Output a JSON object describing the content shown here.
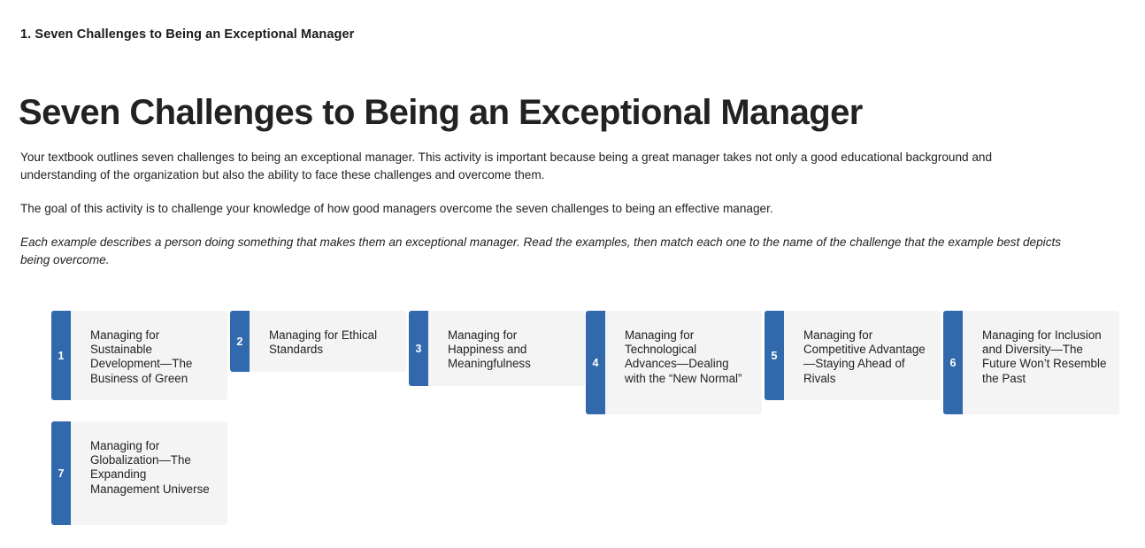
{
  "breadcrumb": "1. Seven Challenges to Being an Exceptional Manager",
  "page_title": "Seven Challenges to Being an Exceptional Manager",
  "body": {
    "intro": "Your textbook outlines seven challenges to being an exceptional manager. This activity is important because being a great manager takes not only a good educational background and understanding of the organization but also the ability to face these challenges and overcome them.",
    "goal": "The goal of this activity is to challenge your knowledge of how good managers overcome the seven challenges to being an effective manager.",
    "instructions": "Each example describes a person doing something that makes them an exceptional manager. Read the examples, then match each one to the name of the challenge that the example best depicts being overcome."
  },
  "colors": {
    "tab_blue": "#3169ac",
    "card_bg": "#f4f4f4",
    "text": "#222222"
  },
  "cards": [
    {
      "number": "1",
      "label": "Managing for Sustainable Development—The Business of Green"
    },
    {
      "number": "2",
      "label": "Managing for Ethical Standards"
    },
    {
      "number": "3",
      "label": "Managing for Happiness and Meaningfulness"
    },
    {
      "number": "4",
      "label": "Managing for Technological Advances—Dealing with the “New Normal”"
    },
    {
      "number": "5",
      "label": "Managing for Competitive Advantage—Staying Ahead of Rivals"
    },
    {
      "number": "6",
      "label": "Managing for Inclusion and Diversity—The Future Won’t Resemble the Past"
    },
    {
      "number": "7",
      "label": "Managing for Globalization—The Expanding Management Universe"
    }
  ]
}
